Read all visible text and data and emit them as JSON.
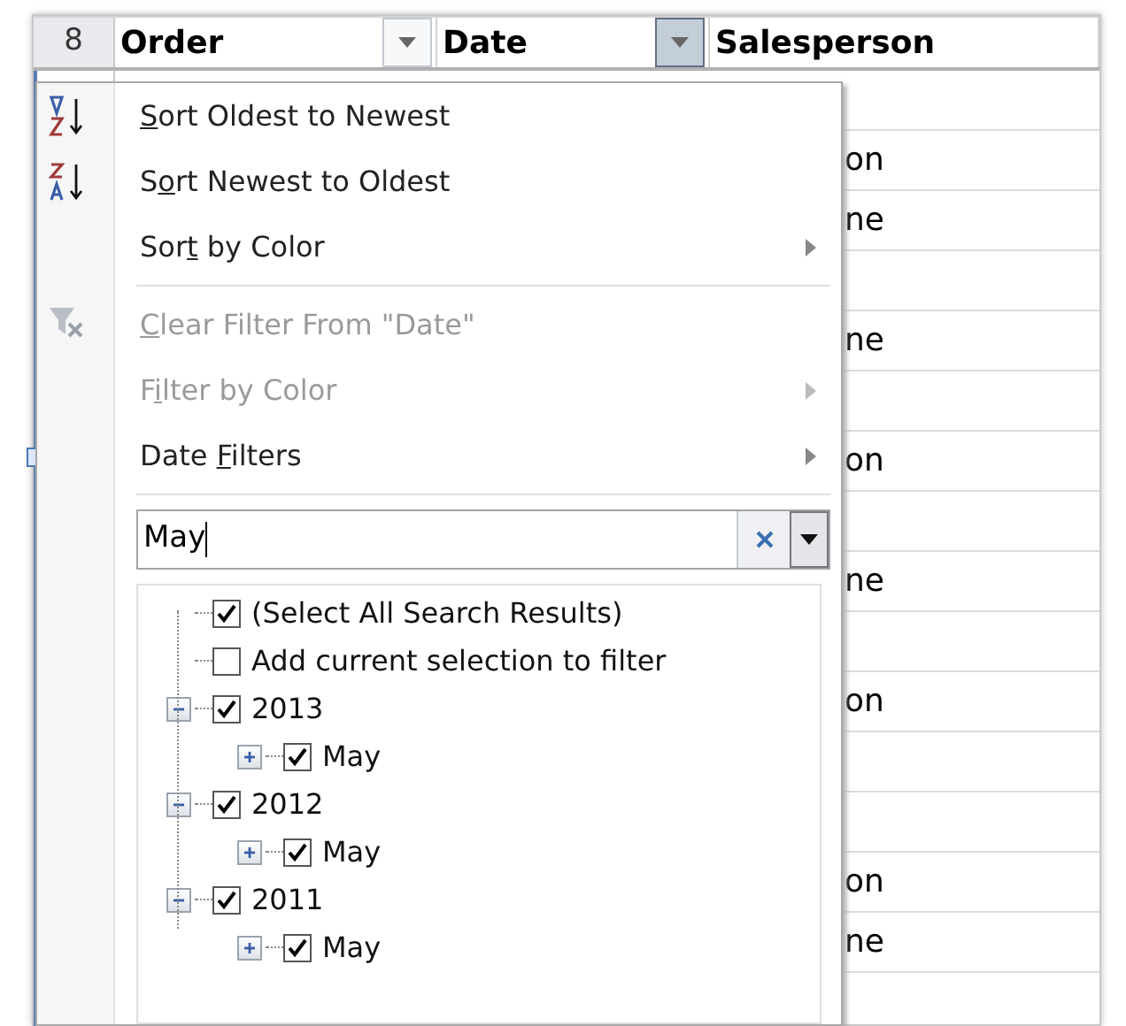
{
  "sheet": {
    "row_number": "8",
    "headers": [
      {
        "label": "Order",
        "filter": {
          "active": false
        }
      },
      {
        "label": "Date",
        "filter": {
          "active": true
        }
      },
      {
        "label": "Salesperson"
      }
    ],
    "salesperson_cells": [
      {},
      {
        "text": "on"
      },
      {
        "text": "ne"
      },
      {},
      {
        "text": "ne"
      },
      {},
      {
        "text": "on"
      },
      {},
      {
        "text": "ne"
      },
      {},
      {
        "text": "on"
      },
      {},
      {},
      {
        "text": "on"
      },
      {
        "text": "ne"
      },
      {}
    ]
  },
  "menu": {
    "items": [
      {
        "kind": "ascending",
        "key": "S",
        "after": "ort Oldest to Newest",
        "disabled": false,
        "submenu": false
      },
      {
        "kind": "descending",
        "before": "S",
        "key": "o",
        "after": "rt Newest to Oldest",
        "disabled": false,
        "submenu": false
      },
      {
        "kind": "item",
        "before": "Sor",
        "key": "t",
        "after": " by Color",
        "disabled": false,
        "submenu": true
      },
      {
        "kind": "divider"
      },
      {
        "kind": "clear",
        "key": "C",
        "after": "lear Filter From \"Date\"",
        "disabled": true,
        "submenu": false
      },
      {
        "kind": "item",
        "before": "F",
        "key": "i",
        "after": "lter by Color",
        "disabled": true,
        "submenu": true
      },
      {
        "kind": "item",
        "before": "Date ",
        "key": "F",
        "after": "ilters",
        "disabled": false,
        "submenu": true
      },
      {
        "kind": "divider"
      }
    ],
    "search": {
      "value": "May"
    },
    "tree": [
      {
        "label": "(Select All Search Results)",
        "checked": true
      },
      {
        "label": "Add current selection to filter",
        "checked": false
      },
      {
        "label": "2013",
        "checked": true,
        "expanded": true,
        "children": [
          {
            "label": "May",
            "checked": true,
            "expanded": false
          }
        ]
      },
      {
        "label": "2012",
        "checked": true,
        "expanded": true,
        "children": [
          {
            "label": "May",
            "checked": true,
            "expanded": false
          }
        ]
      },
      {
        "label": "2011",
        "checked": true,
        "expanded": true,
        "children": [
          {
            "label": "May",
            "checked": true,
            "expanded": false
          }
        ]
      }
    ]
  }
}
